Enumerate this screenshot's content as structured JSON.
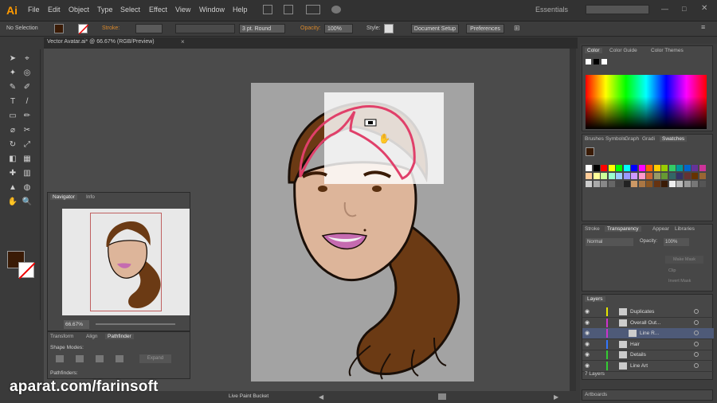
{
  "app": {
    "logo": "Ai"
  },
  "menu": {
    "items": [
      "File",
      "Edit",
      "Object",
      "Type",
      "Select",
      "Effect",
      "View",
      "Window",
      "Help"
    ]
  },
  "workspace": {
    "label": "Essentials"
  },
  "control_bar": {
    "selection": "No Selection",
    "stroke_label": "Stroke:",
    "stroke_profile": "3 pt. Round",
    "opacity_label": "Opacity:",
    "opacity_value": "100%",
    "style_label": "Style:",
    "doc_setup": "Document Setup",
    "preferences": "Preferences"
  },
  "document_tab": {
    "title": "Vector Avatar.ai* @ 66.67% (RGB/Preview)"
  },
  "navigator": {
    "tabs": [
      "Navigator",
      "Info"
    ],
    "zoom": "66.67%"
  },
  "pathfinder": {
    "tabs": [
      "Transform",
      "Align",
      "Pathfinder"
    ],
    "shape_modes": "Shape Modes:",
    "pathfinders": "Pathfinders:",
    "expand": "Expand"
  },
  "color_panel": {
    "tabs": [
      "Color",
      "Color Guide",
      "Color Themes"
    ]
  },
  "swatches_panel": {
    "tabs": [
      "Brushes",
      "Symbols",
      "Graph",
      "Gradi",
      "Swatches"
    ]
  },
  "transparency_panel": {
    "tabs": [
      "Stroke",
      "Transparency",
      "Appear",
      "Libraries"
    ],
    "blend_mode": "Normal",
    "opacity_label": "Opacity:",
    "opacity_value": "100%",
    "make_mask": "Make Mask",
    "clip": "Clip",
    "invert_mask": "Invert Mask"
  },
  "layers_panel": {
    "title": "Layers",
    "rows": [
      {
        "name": "Duplicates",
        "color": "#e6e600"
      },
      {
        "name": "Overall Out...",
        "color": "#cc33cc"
      },
      {
        "name": "Line R...",
        "color": "#cc33cc"
      },
      {
        "name": "Hair",
        "color": "#3377ff"
      },
      {
        "name": "Details",
        "color": "#33cc33"
      },
      {
        "name": "Line Art",
        "color": "#33cc33"
      }
    ],
    "count": "7 Layers"
  },
  "artboards_tab": {
    "label": "Artboards"
  },
  "status": {
    "tool": "Live Paint Bucket"
  },
  "watermark": {
    "text": "aparat.com/farinsoft"
  },
  "colors": {
    "accent": "#ff9a00",
    "skin": "#ddb59a",
    "hair": "#6b3a14",
    "outline": "#1a0f08",
    "highlight_stroke": "#e0406a",
    "fill_box": "#fbe6dc",
    "lips": "#c56bb0"
  }
}
